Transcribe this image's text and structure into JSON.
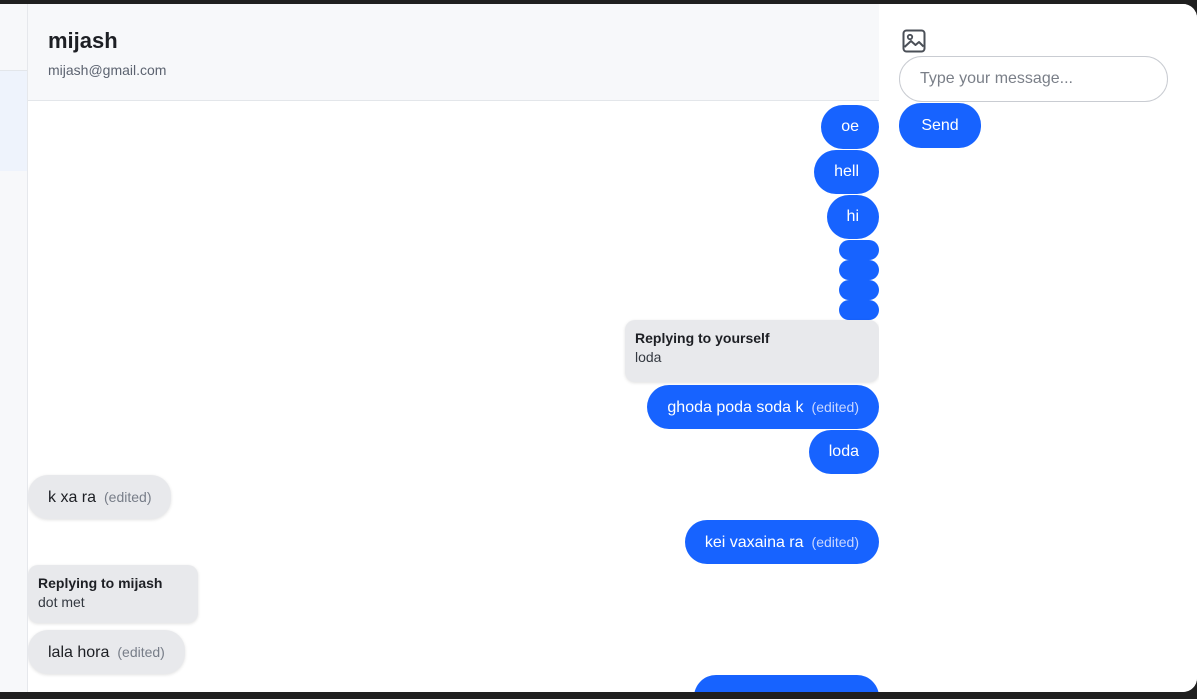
{
  "header": {
    "name": "mijash",
    "email": "mijash@gmail.com"
  },
  "messages": [
    {
      "direction": "out",
      "text": "oe"
    },
    {
      "direction": "out",
      "text": "hell"
    },
    {
      "direction": "out",
      "text": "hi"
    },
    {
      "direction": "out",
      "text": ""
    },
    {
      "direction": "out",
      "text": ""
    },
    {
      "direction": "out",
      "text": ""
    },
    {
      "direction": "out",
      "text": ""
    },
    {
      "direction": "out",
      "reply_title": "Replying to yourself",
      "reply_text": "loda"
    },
    {
      "direction": "out",
      "text": "ghoda poda soda k",
      "edited_label": "(edited)"
    },
    {
      "direction": "out",
      "text": "loda"
    },
    {
      "direction": "in",
      "text": "k xa ra",
      "edited_label": "(edited)"
    },
    {
      "direction": "out",
      "text": "kei vaxaina ra",
      "edited_label": "(edited)"
    },
    {
      "direction": "in",
      "reply_title": "Replying to mijash",
      "reply_text": "dot met"
    },
    {
      "direction": "in",
      "text": "lala hora",
      "edited_label": "(edited)"
    }
  ],
  "composer": {
    "image_icon": "image-icon",
    "placeholder": "Type your message...",
    "value": "",
    "send_label": "Send"
  },
  "colors": {
    "accent": "#1763ff",
    "incoming_bubble": "#e8e9ec",
    "header_bg": "#f7f8fa"
  }
}
